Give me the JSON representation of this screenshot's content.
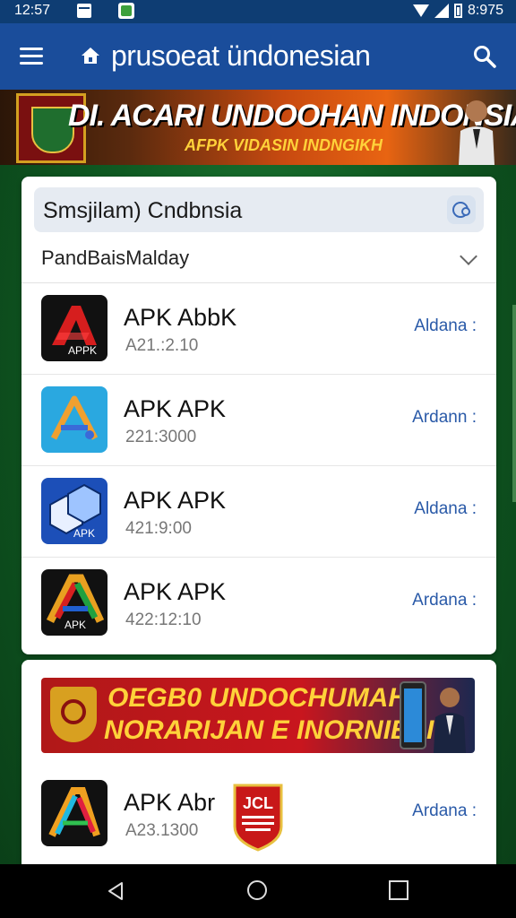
{
  "status_bar": {
    "time": "12:57",
    "right_text": "8:975"
  },
  "app_bar": {
    "title": "prusoeat ündonesian"
  },
  "top_banner": {
    "headline": "DI. ACARI UNDOOHAN INDONSIAI",
    "subline": "AFPK VIDASIN INDNGIKH"
  },
  "search": {
    "query": "Smsjilam) Cndbnsia"
  },
  "filter": {
    "selected": "PandBaisMalday"
  },
  "apps": [
    {
      "name": "APK AbbK",
      "version": "A21.:2.10",
      "action": "Aldana :",
      "icon_label": "APPK",
      "icon": "apk-red-a-icon"
    },
    {
      "name": "APK APK",
      "version": "221:3000",
      "action": "Ardann :",
      "icon_label": "",
      "icon": "apk-triangle-blue-icon"
    },
    {
      "name": "APK APK",
      "version": "421:9:00",
      "action": "Aldana :",
      "icon_label": "APK",
      "icon": "apk-cube-icon"
    },
    {
      "name": "APK APK",
      "version": "422:12:10",
      "action": "Ardana :",
      "icon_label": "APK",
      "icon": "apk-rainbow-a-icon"
    }
  ],
  "mid_banner": {
    "line1": "OEGB0 UNDOCHUMAH",
    "line2": "NORARIJAN E INORNIESI"
  },
  "second_list": [
    {
      "name": "APK Abr",
      "version": "A23.1300",
      "action": "Ardana :",
      "icon": "apk-stripe-a-icon"
    }
  ],
  "overlay_badge": {
    "text": "JCL"
  },
  "colors": {
    "app_bar": "#1a4d9b",
    "status_bar": "#0e3d73",
    "action_text": "#2a5aa8",
    "background": "#0f5a22"
  }
}
